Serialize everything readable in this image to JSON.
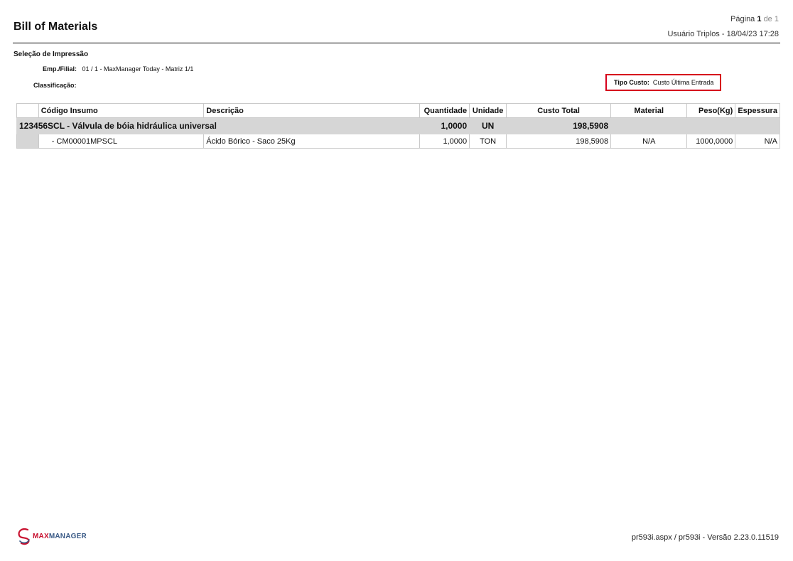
{
  "header": {
    "title": "Bill of Materials",
    "page_label": "Página",
    "page_current": "1",
    "page_of": "de",
    "page_total": "1",
    "user_info": "Usuário Triplos - 18/04/23 17:28"
  },
  "selection": {
    "title": "Seleção de Impressão",
    "filial_label": "Emp./Filial:",
    "filial_value": "01 / 1 - MaxManager Today - Matriz 1/1",
    "classificacao_label": "Classificação:",
    "classificacao_value": "",
    "tipo_custo_label": "Tipo Custo:",
    "tipo_custo_value": "Custo Última Entrada"
  },
  "table": {
    "columns": [
      "Código Insumo",
      "Descrição",
      "Quantidade",
      "Unidade",
      "Custo Total",
      "Material",
      "Peso(Kg)",
      "Espessura"
    ],
    "parent": {
      "name": "123456SCL - Válvula de bóia hidráulica universal",
      "quantidade": "1,0000",
      "unidade": "UN",
      "custo_total": "198,5908"
    },
    "children": [
      {
        "codigo": "- CM00001MPSCL",
        "descricao": "Ácido Bórico - Saco 25Kg",
        "quantidade": "1,0000",
        "unidade": "TON",
        "custo_total": "198,5908",
        "material": "N/A",
        "peso": "1000,0000",
        "espessura": "N/A"
      }
    ]
  },
  "footer": {
    "logo_max": "MAX",
    "logo_manager": "MANAGER",
    "logo_icon": "maxmanager-swirl-logo",
    "version": "pr593i.aspx / pr593i - Versão 2.23.0.11519"
  },
  "colors": {
    "highlight_border": "#d6001c",
    "parent_row_bg": "#d6d6d6",
    "logo_red": "#c8102e",
    "logo_blue": "#3b5b87"
  }
}
